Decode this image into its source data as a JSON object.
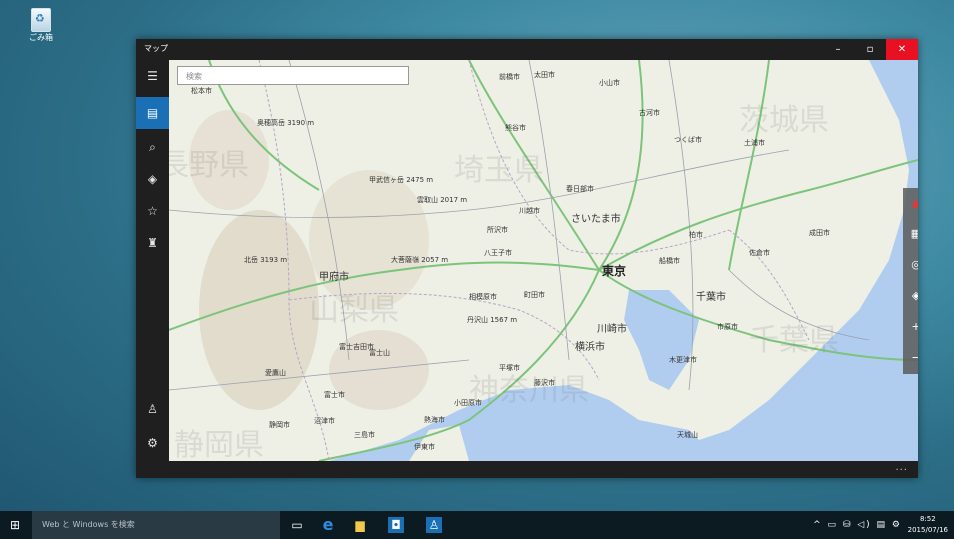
{
  "desktop": {
    "recycle_label": "ごみ箱"
  },
  "window": {
    "title": "マップ",
    "min_icon": "minimize-icon",
    "max_icon": "maximize-icon",
    "close_icon": "close-icon",
    "more": "..."
  },
  "search": {
    "placeholder": "検索"
  },
  "nav": [
    "menu-icon",
    "map-icon",
    "search-icon",
    "directions-icon",
    "favorites-icon",
    "3d-cities-icon",
    "account-icon",
    "settings-icon"
  ],
  "map": {
    "prefectures": [
      "長野県",
      "埼玉県",
      "茨城県",
      "山梨県",
      "千葉県",
      "静岡県",
      "神奈川県"
    ],
    "cities_major": [
      "東京",
      "さいたま市",
      "横浜市",
      "川崎市",
      "千葉市",
      "甲府市"
    ],
    "cities": [
      "松本市",
      "前橋市",
      "太田市",
      "小山市",
      "古河市",
      "つくば市",
      "熊谷市",
      "土浦市",
      "春日部市",
      "川越市",
      "所沢市",
      "八王子市",
      "町田市",
      "相模原市",
      "平塚市",
      "藤沢市",
      "富士市",
      "沼津市",
      "三島市",
      "木更津市",
      "市原市",
      "船橋市",
      "柏市",
      "佐倉市",
      "成田市",
      "富士吉田市",
      "静岡市",
      "伊東市",
      "熱海市",
      "小田原市"
    ],
    "peaks": [
      "奥穂高岳 3190 m",
      "甲武信ヶ岳 2475 m",
      "雲取山 2017 m",
      "北岳 3193 m",
      "大菩薩嶺 2057 m",
      "丹沢山 1567 m",
      "富士山",
      "愛鷹山",
      "天城山"
    ]
  },
  "tools": [
    "compass-icon",
    "street-view-icon",
    "locate-icon",
    "layers-icon",
    "zoom-in-icon",
    "zoom-out-icon"
  ],
  "taskbar": {
    "search_placeholder": "Web と Windows を検索",
    "time": "8:52",
    "date": "2015/07/16"
  }
}
